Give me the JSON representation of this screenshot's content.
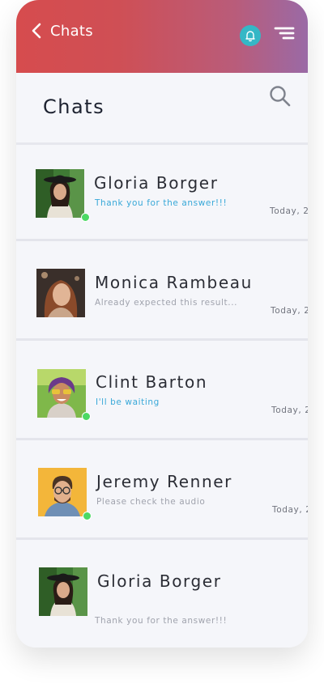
{
  "header": {
    "title": "Chats"
  },
  "page": {
    "heading": "Chats"
  },
  "colors": {
    "gradient_start": "#d64c4e",
    "gradient_end": "#9a6aa6",
    "bell_bg": "#35b7c6",
    "online": "#4cd964",
    "message_blue": "#38a8d8"
  },
  "icons": [
    "chevron-left-icon",
    "bell-icon",
    "menu-icon",
    "search-icon"
  ],
  "chats": [
    {
      "name": "Gloria Borger",
      "message": "Thank you for the answer!!!",
      "time": "Today, 2",
      "online": true
    },
    {
      "name": "Monica Rambeau",
      "message": "Already expected this result...",
      "time": "Today, 2",
      "online": false
    },
    {
      "name": "Clint Barton",
      "message": "I'll be waiting",
      "time": "Today, 2",
      "online": true
    },
    {
      "name": "Jeremy Renner",
      "message": "Please check the audio",
      "time": "Today, 2",
      "online": true
    },
    {
      "name": "Gloria Borger",
      "message": "Thank you for the answer!!!",
      "time": "",
      "online": false
    }
  ]
}
